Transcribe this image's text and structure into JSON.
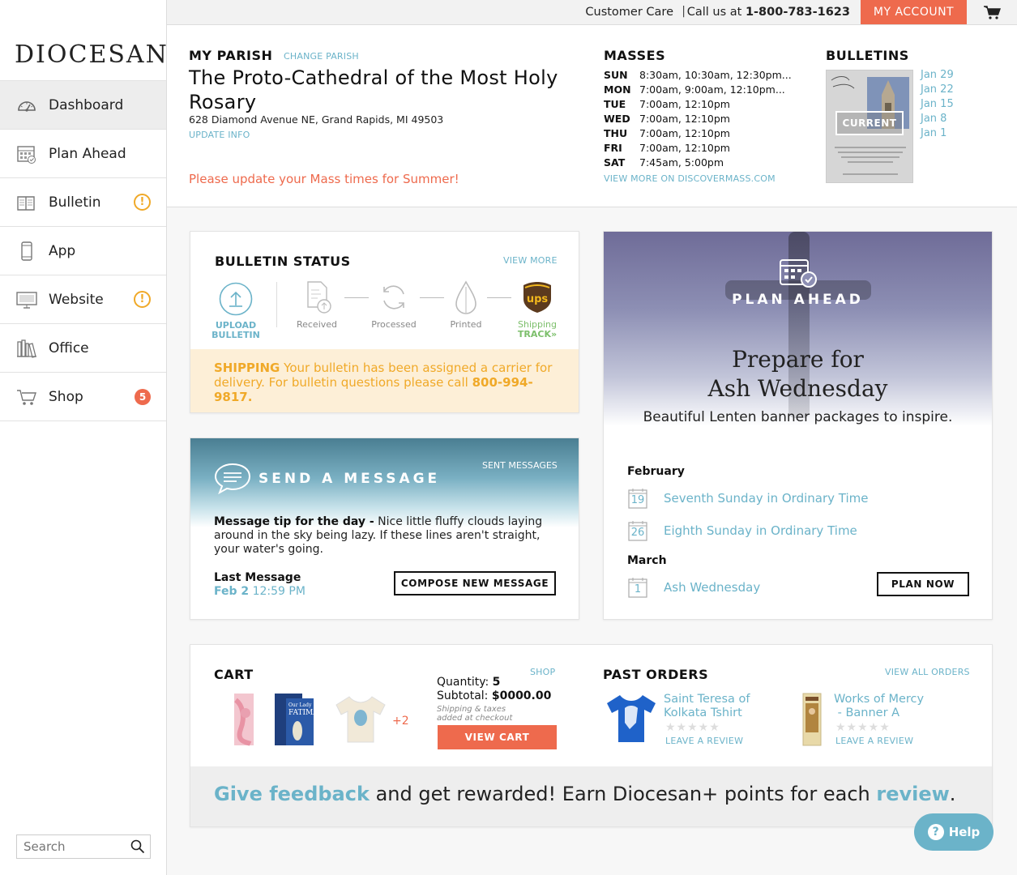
{
  "topbar": {
    "customer_care": "Customer Care",
    "separator": "|",
    "call_prefix": "Call us at",
    "phone": "1-800-783-1623",
    "my_account": "MY ACCOUNT"
  },
  "sidebar": {
    "logo": "DIOCESAN",
    "items": [
      {
        "label": "Dashboard",
        "icon": "dashboard-gauge-icon",
        "active": true
      },
      {
        "label": "Plan Ahead",
        "icon": "calendar-icon"
      },
      {
        "label": "Bulletin",
        "icon": "bulletin-book-icon",
        "alert": "!"
      },
      {
        "label": "App",
        "icon": "phone-icon"
      },
      {
        "label": "Website",
        "icon": "monitor-icon",
        "alert": "!"
      },
      {
        "label": "Office",
        "icon": "office-books-icon"
      },
      {
        "label": "Shop",
        "icon": "cart-icon",
        "badge": "5"
      }
    ],
    "search_placeholder": "Search"
  },
  "parish": {
    "label": "MY PARISH",
    "change": "CHANGE PARISH",
    "name": "The Proto-Cathedral of the Most Holy Rosary",
    "address": "628 Diamond Avenue NE, Grand Rapids, MI 49503",
    "update": "UPDATE INFO",
    "warning": "Please update your Mass times for Summer!"
  },
  "masses": {
    "title": "MASSES",
    "rows": [
      {
        "day": "SUN",
        "times": "8:30am, 10:30am, 12:30pm..."
      },
      {
        "day": "MON",
        "times": "7:00am, 9:00am, 12:10pm..."
      },
      {
        "day": "TUE",
        "times": "7:00am, 12:10pm"
      },
      {
        "day": "WED",
        "times": "7:00am, 12:10pm"
      },
      {
        "day": "THU",
        "times": "7:00am, 12:10pm"
      },
      {
        "day": "FRI",
        "times": "7:00am, 12:10pm"
      },
      {
        "day": "SAT",
        "times": "7:45am, 5:00pm"
      }
    ],
    "more": "VIEW MORE ON DISCOVERMASS.COM"
  },
  "bulletins": {
    "title": "BULLETINS",
    "current": "CURRENT",
    "dates": [
      "Jan 29",
      "Jan 22",
      "Jan 15",
      "Jan 8",
      "Jan 1"
    ]
  },
  "bulletin_status": {
    "title": "BULLETIN STATUS",
    "more": "VIEW MORE",
    "upload_line1": "UPLOAD",
    "upload_line2": "BULLETIN",
    "steps": [
      "Received",
      "Processed",
      "Printed",
      "Shipping"
    ],
    "track": "TRACK»",
    "alert_label": "SHIPPING",
    "alert_text": "Your bulletin has been assigned a carrier for delivery. For bulletin questions please call",
    "alert_phone": "800-994-9817."
  },
  "send_message": {
    "title": "SEND A MESSAGE",
    "sent": "SENT MESSAGES",
    "tip_label": "Message tip for the day -",
    "tip_text": "Nice little fluffy clouds laying around in the sky being lazy. If these lines aren't straight, your water's going.",
    "last_label": "Last Message",
    "last_date": "Feb 2",
    "last_time": "12:59 PM",
    "compose": "COMPOSE NEW MESSAGE"
  },
  "plan_ahead": {
    "title": "PLAN AHEAD",
    "heading_line1": "Prepare for",
    "heading_line2": "Ash Wednesday",
    "subheading": "Beautiful Lenten banner packages to inspire.",
    "months": [
      {
        "name": "February",
        "events": [
          {
            "day": "19",
            "name": "Seventh Sunday in Ordinary Time"
          },
          {
            "day": "26",
            "name": "Eighth Sunday in Ordinary Time"
          }
        ]
      },
      {
        "name": "March",
        "events": [
          {
            "day": "1",
            "name": "Ash Wednesday"
          }
        ]
      }
    ],
    "plan_now": "PLAN NOW"
  },
  "cart": {
    "title": "CART",
    "shop": "SHOP",
    "more": "+2",
    "quantity_label": "Quantity:",
    "quantity": "5",
    "subtotal_label": "Subtotal:",
    "subtotal": "$0000.00",
    "shipping_line1": "Shipping & taxes",
    "shipping_line2": "added at checkout",
    "view_cart": "VIEW CART"
  },
  "past_orders": {
    "title": "PAST ORDERS",
    "view_all": "VIEW ALL ORDERS",
    "items": [
      {
        "name_line1": "Saint Teresa of",
        "name_line2": "Kolkata Tshirt",
        "review": "LEAVE A REVIEW",
        "stars": "★★★★★"
      },
      {
        "name_line1": "Works of Mercy",
        "name_line2": " - Banner A",
        "review": "LEAVE A REVIEW",
        "stars": "★★★★★"
      }
    ]
  },
  "feedback": {
    "part1": "Give feedback",
    "part2": " and get rewarded! Earn Diocesan+ points for each ",
    "part3": "review",
    "part4": "."
  },
  "help": {
    "label": "Help",
    "icon_glyph": "?"
  },
  "colors": {
    "accent_blue": "#6bb3c9",
    "accent_orange": "#ee6a4d",
    "warning_yellow": "#f0a928"
  }
}
